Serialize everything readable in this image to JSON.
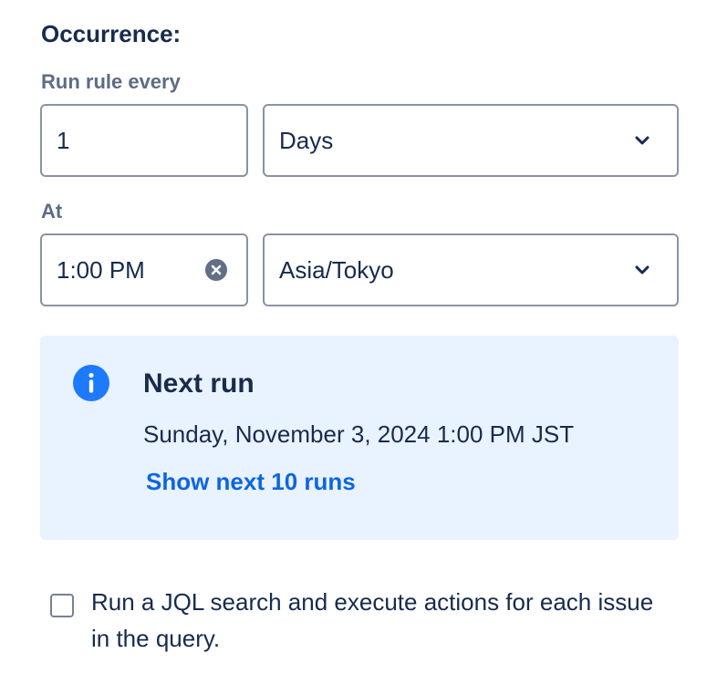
{
  "occurrence": {
    "title": "Occurrence:",
    "run_every_label": "Run rule every",
    "interval_value": "1",
    "interval_unit": "Days",
    "at_label": "At",
    "time_value": "1:00 PM",
    "timezone": "Asia/Tokyo"
  },
  "next_run": {
    "title": "Next run",
    "date": "Sunday, November 3, 2024 1:00 PM JST",
    "link": "Show next 10 runs"
  },
  "jql": {
    "checkbox_label": "Run a JQL search and execute actions for each issue in the query.",
    "checked": false
  },
  "icons": {
    "chevron": "chevron-down-icon",
    "clear": "clear-icon",
    "info": "info-icon"
  },
  "colors": {
    "text": "#172B4D",
    "label": "#5E6C84",
    "border": "#8993A4",
    "panel_bg": "#E9F2FF",
    "link": "#0C66E4",
    "info_icon": "#1D7AFC"
  }
}
